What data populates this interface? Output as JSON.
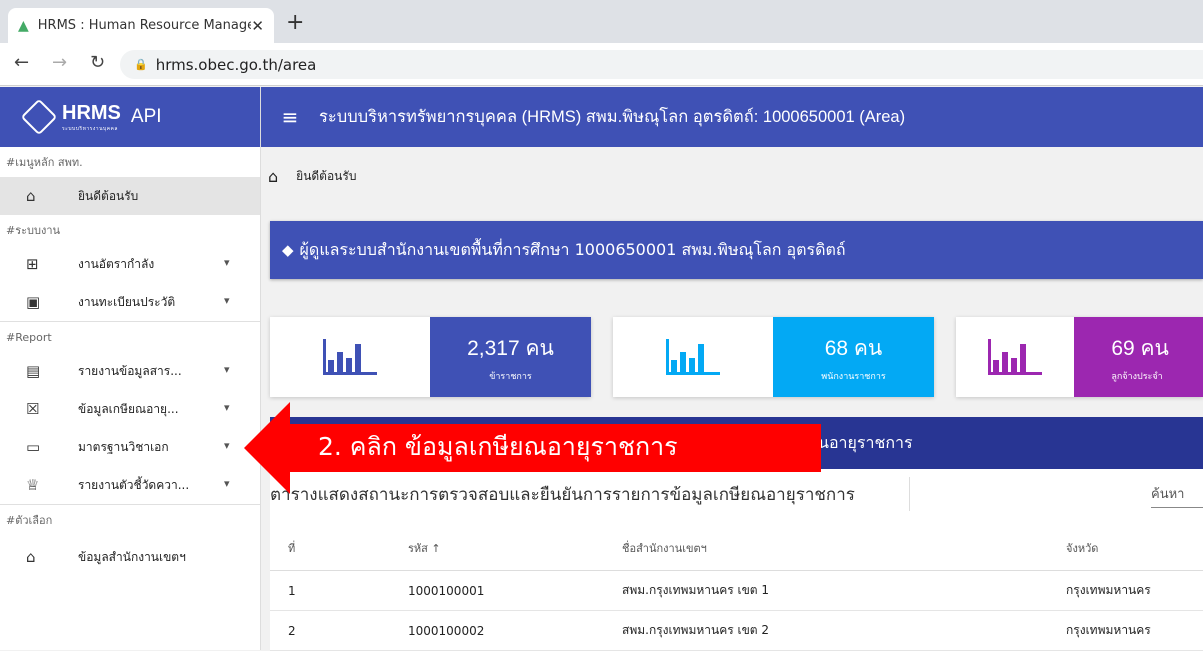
{
  "browser": {
    "tab_title": "HRMS : Human Resource Manage",
    "url": "hrms.obec.go.th/area"
  },
  "brand": {
    "name": "HRMS",
    "sub": "ระบบบริหารงานบุคคล",
    "api": "API"
  },
  "sidebar": {
    "sec1": "#เมนูหลัก สพท.",
    "welcome": "ยินดีต้อนรับ",
    "sec2": "#ระบบงาน",
    "manpower": "งานอัตรากำลัง",
    "registry": "งานทะเบียนประวัติ",
    "sec3": "#Report",
    "report_info": "รายงานข้อมูลสาร...",
    "retirement": "ข้อมูลเกษียณอายุ...",
    "standards": "มาตรฐานวิชาเอก",
    "indicators": "รายงานตัวชี้วัดควา...",
    "sec4": "#ตัวเลือก",
    "office_info": "ข้อมูลสำนักงานเขตฯ"
  },
  "appbar": {
    "title": "ระบบบริหารทรัพยากรบุคคล (HRMS) สพม.พิษณุโลก อุตรดิตถ์: 1000650001 (Area)"
  },
  "breadcrumb": {
    "current": "ยินดีต้อนรับ"
  },
  "banner": {
    "text": "ผู้ดูแลระบบสำนักงานเขตพื้นที่การศึกษา 1000650001 สพม.พิษณุโลก อุตรดิตถ์"
  },
  "cards": [
    {
      "value": "2,317 คน",
      "label": "ข้าราชการ",
      "color": "#3f51b5"
    },
    {
      "value": "68 คน",
      "label": "พนักงานราชการ",
      "color": "#03a9f4"
    },
    {
      "value": "69 คน",
      "label": "ลูกจ้างประจำ",
      "color": "#9c27b0"
    }
  ],
  "section": {
    "title_tail": "นอายุราชการ"
  },
  "table": {
    "caption": "ตารางแสดงสถานะการตรวจสอบและยืนยันการรายการข้อมูลเกษียณอายุราชการ",
    "search_placeholder": "ค้นหา",
    "headers": {
      "no": "ที่",
      "code": "รหัส ↑",
      "name": "ชื่อสำนักงานเขตฯ",
      "province": "จังหวัด"
    },
    "rows": [
      {
        "no": "1",
        "code": "1000100001",
        "name": "สพม.กรุงเทพมหานคร เขต 1",
        "province": "กรุงเทพมหานคร"
      },
      {
        "no": "2",
        "code": "1000100002",
        "name": "สพม.กรุงเทพมหานคร เขต 2",
        "province": "กรุงเทพมหานคร"
      }
    ]
  },
  "callout": {
    "text": "2. คลิก ข้อมูลเกษียณอายุราชการ",
    "color": "#ff0000"
  }
}
